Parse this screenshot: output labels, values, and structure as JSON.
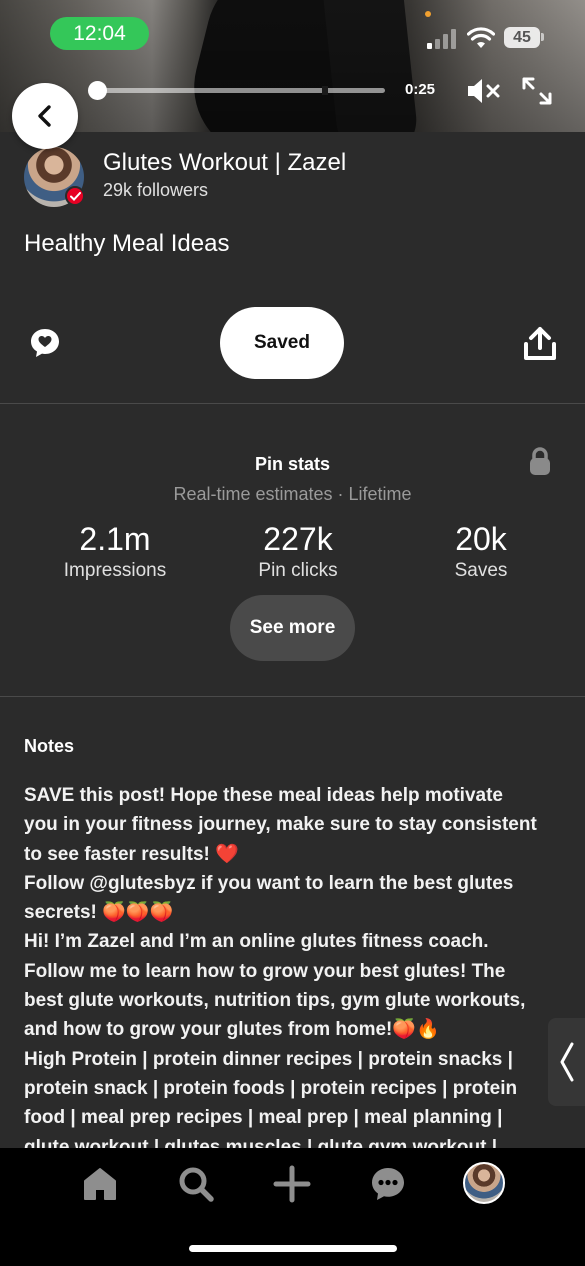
{
  "status_bar": {
    "time": "12:04",
    "battery": "45"
  },
  "video": {
    "elapsed": "0:25",
    "progress_fraction": 0.03
  },
  "creator": {
    "name": "Glutes Workout | Zazel",
    "followers": "29k followers"
  },
  "board": {
    "title": "Healthy Meal Ideas"
  },
  "actions": {
    "saved_label": "Saved"
  },
  "pin_stats": {
    "title": "Pin stats",
    "subtitle": "Real-time estimates · Lifetime",
    "items": [
      {
        "value": "2.1m",
        "label": "Impressions"
      },
      {
        "value": "227k",
        "label": "Pin clicks"
      },
      {
        "value": "20k",
        "label": "Saves"
      }
    ],
    "see_more_label": "See more"
  },
  "notes": {
    "title": "Notes",
    "lines": [
      "SAVE this post! Hope these meal ideas help motivate",
      "you in your fitness journey, make sure to stay consistent",
      "to see faster results! ❤️",
      "Follow @glutesbyz if you want to learn the best glutes",
      "secrets! 🍑🍑🍑",
      "Hi! I’m Zazel and I’m an online glutes fitness coach.",
      "Follow me to learn how to grow your best glutes! The",
      "best glute workouts, nutrition tips, gym glute workouts,",
      "and how to grow your glutes from home!🍑🔥",
      "High Protein | protein dinner recipes | protein snacks |",
      "protein snack | protein foods | protein recipes | protein",
      "food | meal prep recipes | meal prep | meal planning |",
      "glute workout | glutes muscles | glute gym workout |"
    ]
  },
  "colors": {
    "status_pill": "#34c759",
    "verified_badge": "#e60023",
    "sheet_background": "#2b2b2b"
  },
  "icons": {
    "back": "chevron-left-icon",
    "mute": "speaker-muted-icon",
    "fullscreen": "expand-icon",
    "comment": "comment-heart-icon",
    "share": "share-upload-icon",
    "lock": "lock-icon",
    "home": "home-icon",
    "search": "search-icon",
    "create": "plus-icon",
    "messages": "chat-icon"
  }
}
